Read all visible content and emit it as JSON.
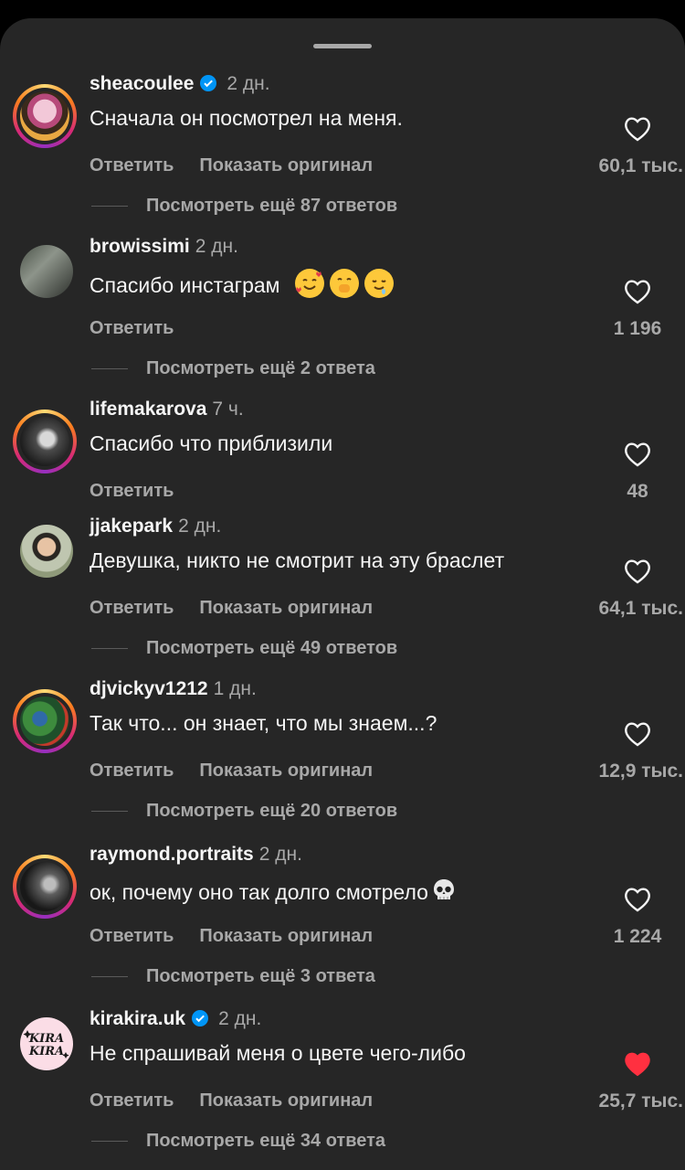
{
  "comments": [
    {
      "username": "sheacoulee",
      "verified": true,
      "time": "2 дн.",
      "text": "Сначала он посмотрел на меня.",
      "reply": "Ответить",
      "show_original": "Показать оригинал",
      "likes": "60,1 тыс.",
      "liked": false,
      "view_replies": "Посмотреть ещё 87 ответов"
    },
    {
      "username": "browissimi",
      "verified": false,
      "time": "2 дн.",
      "text": "Спасибо инстаграм",
      "reply": "Ответить",
      "likes": "1 196",
      "liked": false,
      "view_replies": "Посмотреть ещё 2 ответа"
    },
    {
      "username": "lifemakarova",
      "verified": false,
      "time": "7 ч.",
      "text": "Спасибо что приблизили",
      "reply": "Ответить",
      "likes": "48",
      "liked": false
    },
    {
      "username": "jjakepark",
      "verified": false,
      "time": "2 дн.",
      "text": "Девушка, никто не смотрит на эту браслет",
      "reply": "Ответить",
      "show_original": "Показать оригинал",
      "likes": "64,1 тыс.",
      "liked": false,
      "view_replies": "Посмотреть ещё 49 ответов"
    },
    {
      "username": "djvickyv1212",
      "verified": false,
      "time": "1 дн.",
      "text": "Так что... он знает, что мы знаем...?",
      "reply": "Ответить",
      "show_original": "Показать оригинал",
      "likes": "12,9 тыс.",
      "liked": false,
      "view_replies": "Посмотреть ещё 20 ответов"
    },
    {
      "username": "raymond.portraits",
      "verified": false,
      "time": "2 дн.",
      "text": "ок, почему оно так долго смотрело",
      "reply": "Ответить",
      "show_original": "Показать оригинал",
      "likes": "1 224",
      "liked": false,
      "view_replies": "Посмотреть ещё 3 ответа"
    },
    {
      "username": "kirakira.uk",
      "verified": true,
      "time": "2 дн.",
      "text": "Не спрашивай меня о цвете чего-либо",
      "reply": "Ответить",
      "show_original": "Показать оригинал",
      "likes": "25,7 тыс.",
      "liked": true,
      "view_replies": "Посмотреть ещё 34 ответа"
    }
  ],
  "avatar_logo_text": "KIRA KIRA",
  "icons": {
    "verified": "verified-badge-icon",
    "like": "heart-icon",
    "skull": "skull-emoji"
  },
  "colors": {
    "background": "#262626",
    "text": "#f5f5f5",
    "secondary": "#a8a8a8",
    "verified": "#0095f6",
    "liked": "#ff3040"
  }
}
